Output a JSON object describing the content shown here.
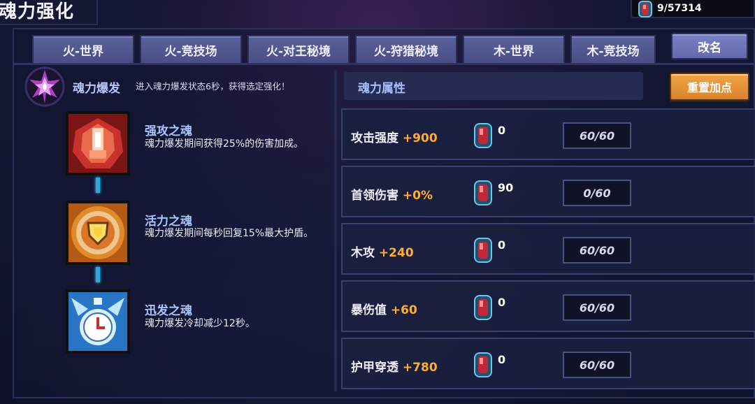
{
  "header": {
    "title": "魂力强化",
    "currency_value": "9/57314"
  },
  "tabs": [
    {
      "label": "火-世界"
    },
    {
      "label": "火-竞技场"
    },
    {
      "label": "火-对王秘境"
    },
    {
      "label": "火-狩猎秘境"
    },
    {
      "label": "木-世界"
    },
    {
      "label": "木-竞技场"
    }
  ],
  "rename_label": "改名",
  "burst": {
    "label": "魂力爆发",
    "description": "进入魂力爆发状态6秒，获得选定强化！"
  },
  "souls": [
    {
      "name": "强攻之魂",
      "description": "魂力爆发期间获得25%的伤害加成。",
      "icon": "fist-rune-icon"
    },
    {
      "name": "活力之魂",
      "description": "魂力爆发期间每秒回复15%最大护盾。",
      "icon": "shield-rune-icon"
    },
    {
      "name": "迅发之魂",
      "description": "魂力爆发冷却减少12秒。",
      "icon": "clock-rune-icon"
    }
  ],
  "attributes_title": "魂力属性",
  "reset_label": "重置加点",
  "attributes": [
    {
      "name": "攻击强度",
      "bonus": "+900",
      "gems": "0",
      "level": "60/60"
    },
    {
      "name": "首领伤害",
      "bonus": "+0%",
      "gems": "90",
      "level": "0/60"
    },
    {
      "name": "木攻",
      "bonus": "+240",
      "gems": "0",
      "level": "60/60"
    },
    {
      "name": "暴伤值",
      "bonus": "+60",
      "gems": "0",
      "level": "60/60"
    },
    {
      "name": "护甲穿透",
      "bonus": "+780",
      "gems": "0",
      "level": "60/60"
    }
  ],
  "colors": {
    "accent_orange": "#ffae2e",
    "tab_purple": "#5a6099",
    "link_cyan": "#2fa8d8"
  }
}
